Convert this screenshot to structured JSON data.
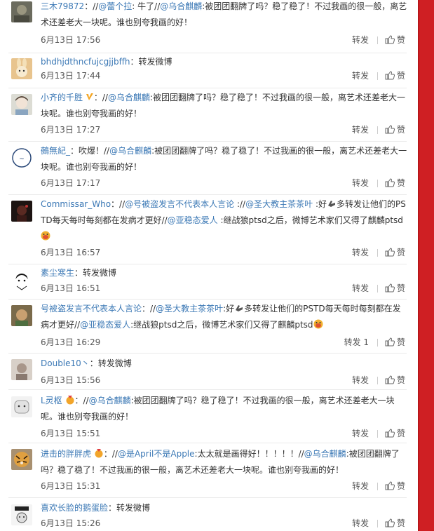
{
  "like_label": "赞",
  "comments": [
    {
      "user": "三木79872",
      "sep": "：//",
      "m1": "@蕾个拉",
      "t1": ": 牛了//",
      "m2": "@乌合麒麟",
      "t2": ":被团团翻牌了吗？稳了稳了！不过我画的很一般，离艺术还差老大一块呢。谁也别夸我画的好！",
      "time": "6月13日 17:56",
      "forward": "转发"
    },
    {
      "user": "bhdhjdthncfujcgjjbffh",
      "t1": "：转发微博",
      "time": "6月13日 17:44",
      "forward": "转发"
    },
    {
      "user": "小齐的千胜",
      "t1": "：//",
      "m1": "@乌合麒麟",
      "t2": ":被团团翻牌了吗？稳了稳了！不过我画的很一般，离艺术还差老大一块呢。谁也别夸我画的好！",
      "time": "6月13日 17:27",
      "forward": "转发"
    },
    {
      "user": "鵺無紀_",
      "t1": "：吹爆！//",
      "m1": "@乌合麒麟",
      "t2": ":被团团翻牌了吗？稳了稳了！不过我画的很一般，离艺术还差老大一块呢。谁也别夸我画的好！",
      "time": "6月13日 17:17",
      "forward": "转发"
    },
    {
      "user": "Commissar_Who",
      "t1": "：//",
      "m1": "@号被盗发言不代表本人言论",
      "t2": " ://",
      "m2": "@圣大教主茶茶叶",
      "t3": " :好",
      "t4": "多转发让他们的PSTD每天每时每刻都在发病才更好//",
      "m3": "@亚稳态爱人",
      "t5": " :继战狼ptsd之后，微博艺术家们又得了麒麟ptsd",
      "time": "6月13日 16:57",
      "forward": "转发"
    },
    {
      "user": "素尘寒生",
      "t1": "：转发微博",
      "time": "6月13日 16:51",
      "forward": "转发"
    },
    {
      "user": "号被盗发言不代表本人言论",
      "t1": "：//",
      "m1": "@圣大教主茶茶叶",
      "t2": ":好",
      "t3": "多转发让他们的PSTD每天每时每刻都在发病才更好//",
      "m2": "@亚稳态爱人",
      "t4": ":继战狼ptsd之后，微博艺术家们又得了麒麟ptsd",
      "time": "6月13日 16:29",
      "forward": "转发 1"
    },
    {
      "user": "Double10丶",
      "t1": "：转发微博",
      "time": "6月13日 15:56",
      "forward": "转发"
    },
    {
      "user": "L灵枢",
      "t1": "：//",
      "m1": "@乌合麒麟",
      "t2": ":被团团翻牌了吗？稳了稳了！不过我画的很一般，离艺术还差老大一块呢。谁也别夸我画的好！",
      "time": "6月13日 15:51",
      "forward": "转发"
    },
    {
      "user": "进击的胖胖虎",
      "t1": "：//",
      "m1": "@是April不是Apple",
      "t2": ":太太就是画得好！！！！！//",
      "m2": "@乌合麒麟",
      "t3": ":被团团翻牌了吗？稳了稳了！不过我画的很一般，离艺术还差老大一块呢。谁也别夸我画的好！",
      "time": "6月13日 15:31",
      "forward": "转发"
    },
    {
      "user": "喜欢长脸的鹅蛋脸",
      "t1": "：转发微博",
      "time": "6月13日 15:26",
      "forward": "转发"
    }
  ]
}
